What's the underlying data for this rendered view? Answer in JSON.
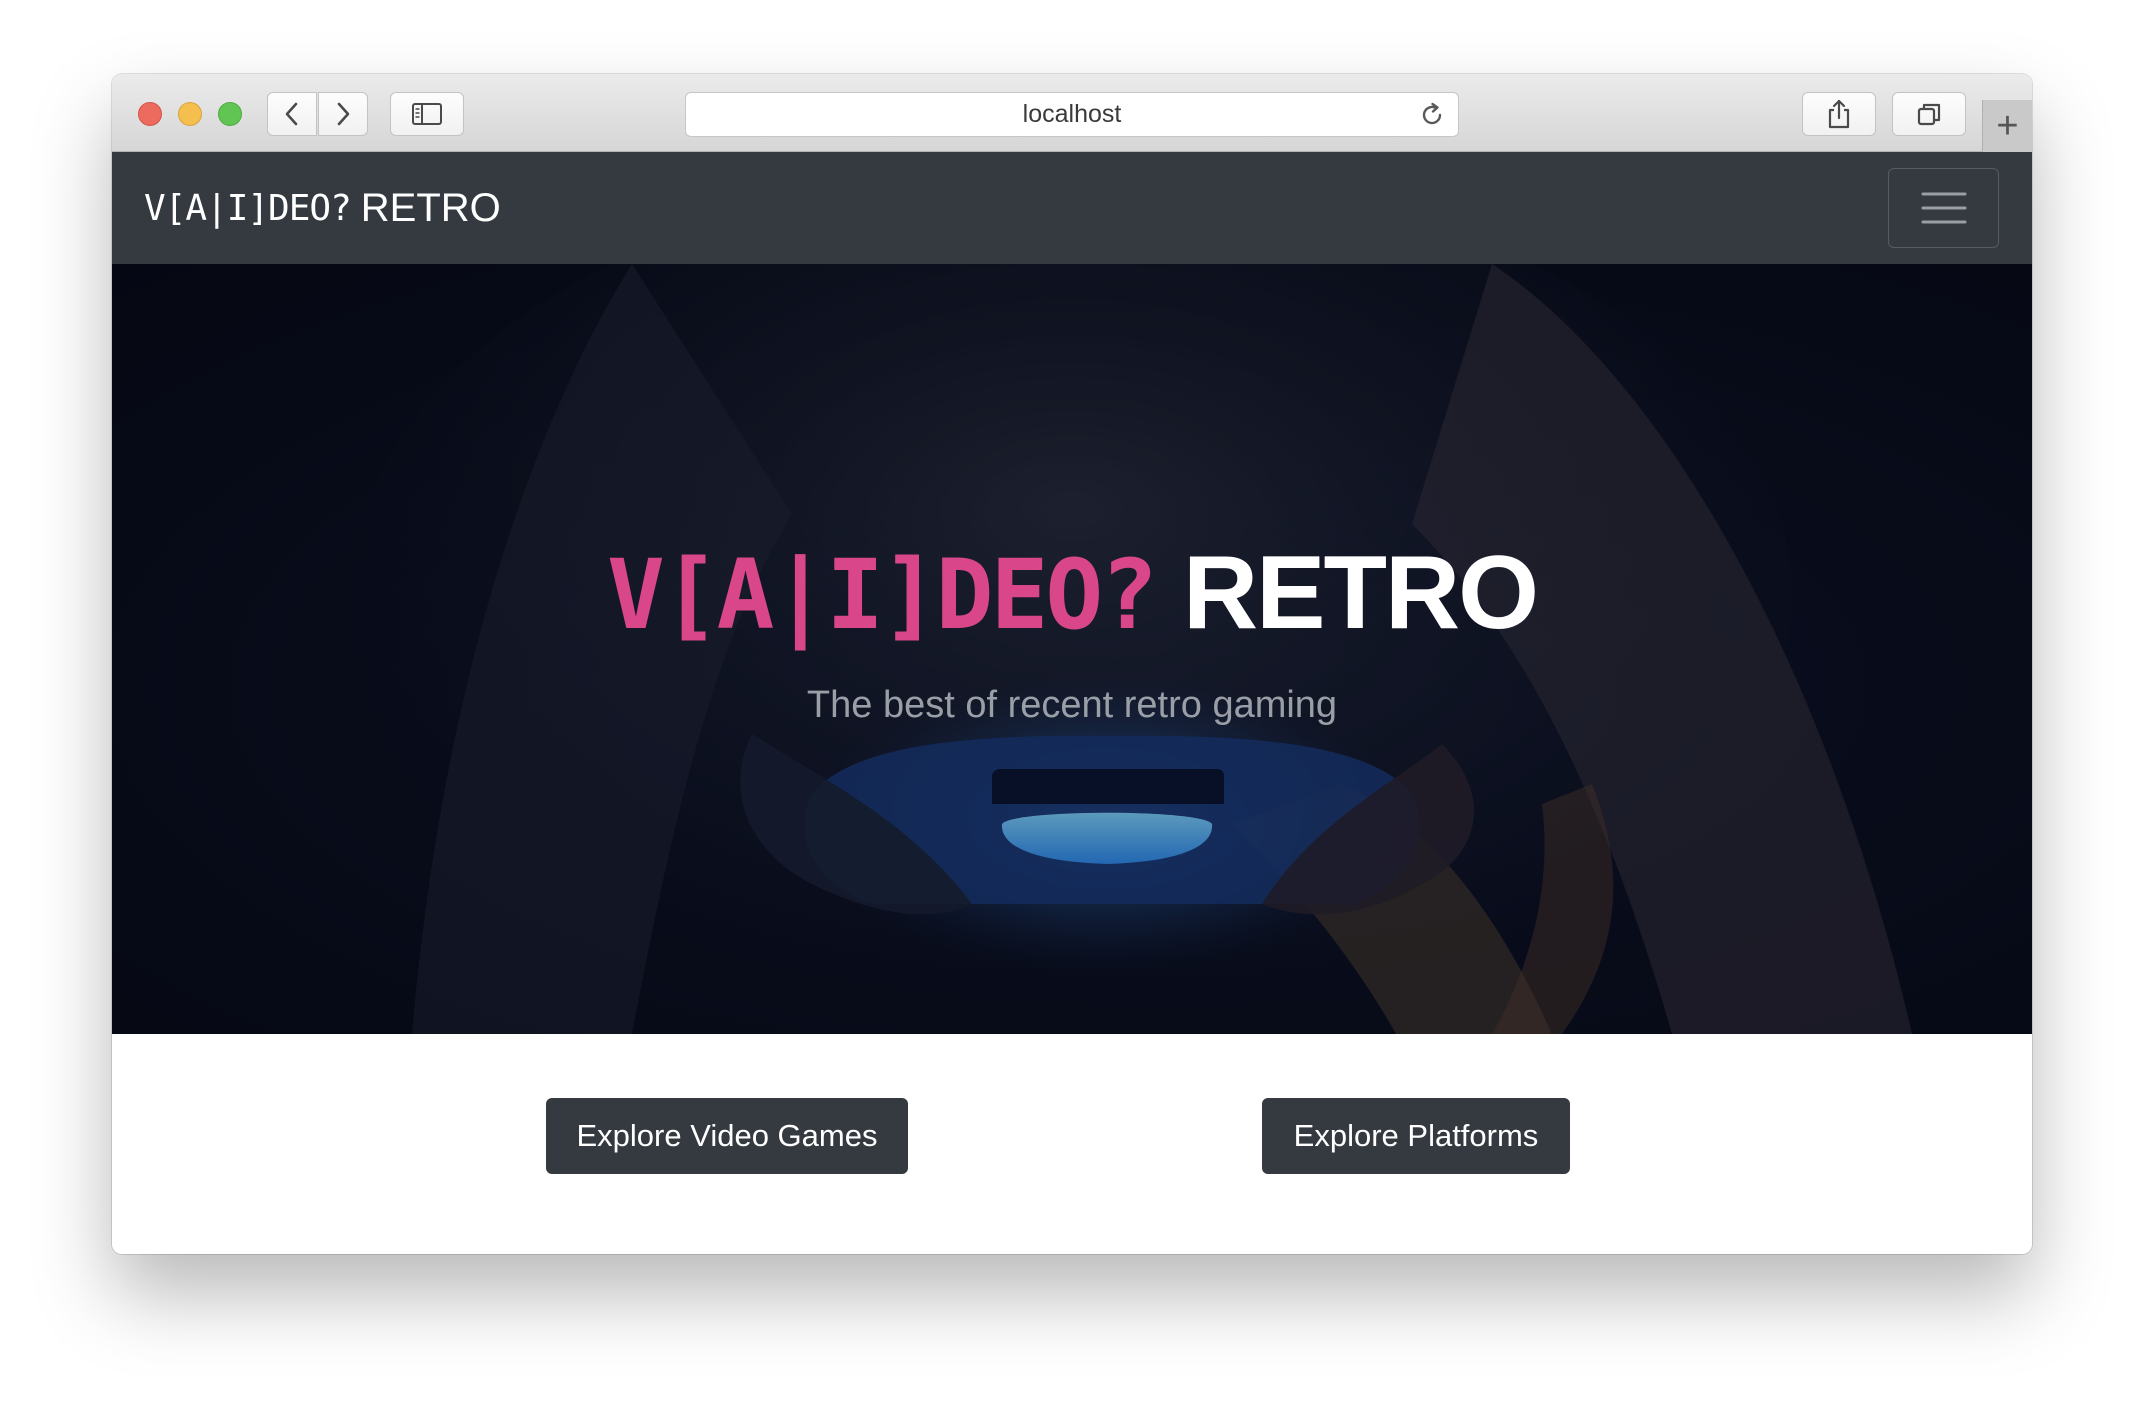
{
  "browser": {
    "url": "localhost",
    "icons": {
      "back": "chevron-left-icon",
      "forward": "chevron-right-icon",
      "sidebar": "sidebar-icon",
      "reload": "reload-icon",
      "share": "share-icon",
      "tabs": "tabs-overview-icon",
      "new_tab": "plus-icon"
    },
    "new_tab_glyph": "+"
  },
  "navbar": {
    "brand_mono": "V[A|I]DEO?",
    "brand_text": "RETRO",
    "toggler_icon": "hamburger-menu-icon",
    "background": "#343a40"
  },
  "hero": {
    "title_mono": "V[A|I]DEO?",
    "title_text": "RETRO",
    "subtitle": "The best of recent retro gaming",
    "accent_color": "#d9478a"
  },
  "actions": {
    "explore_games": "Explore Video Games",
    "explore_platforms": "Explore Platforms"
  }
}
